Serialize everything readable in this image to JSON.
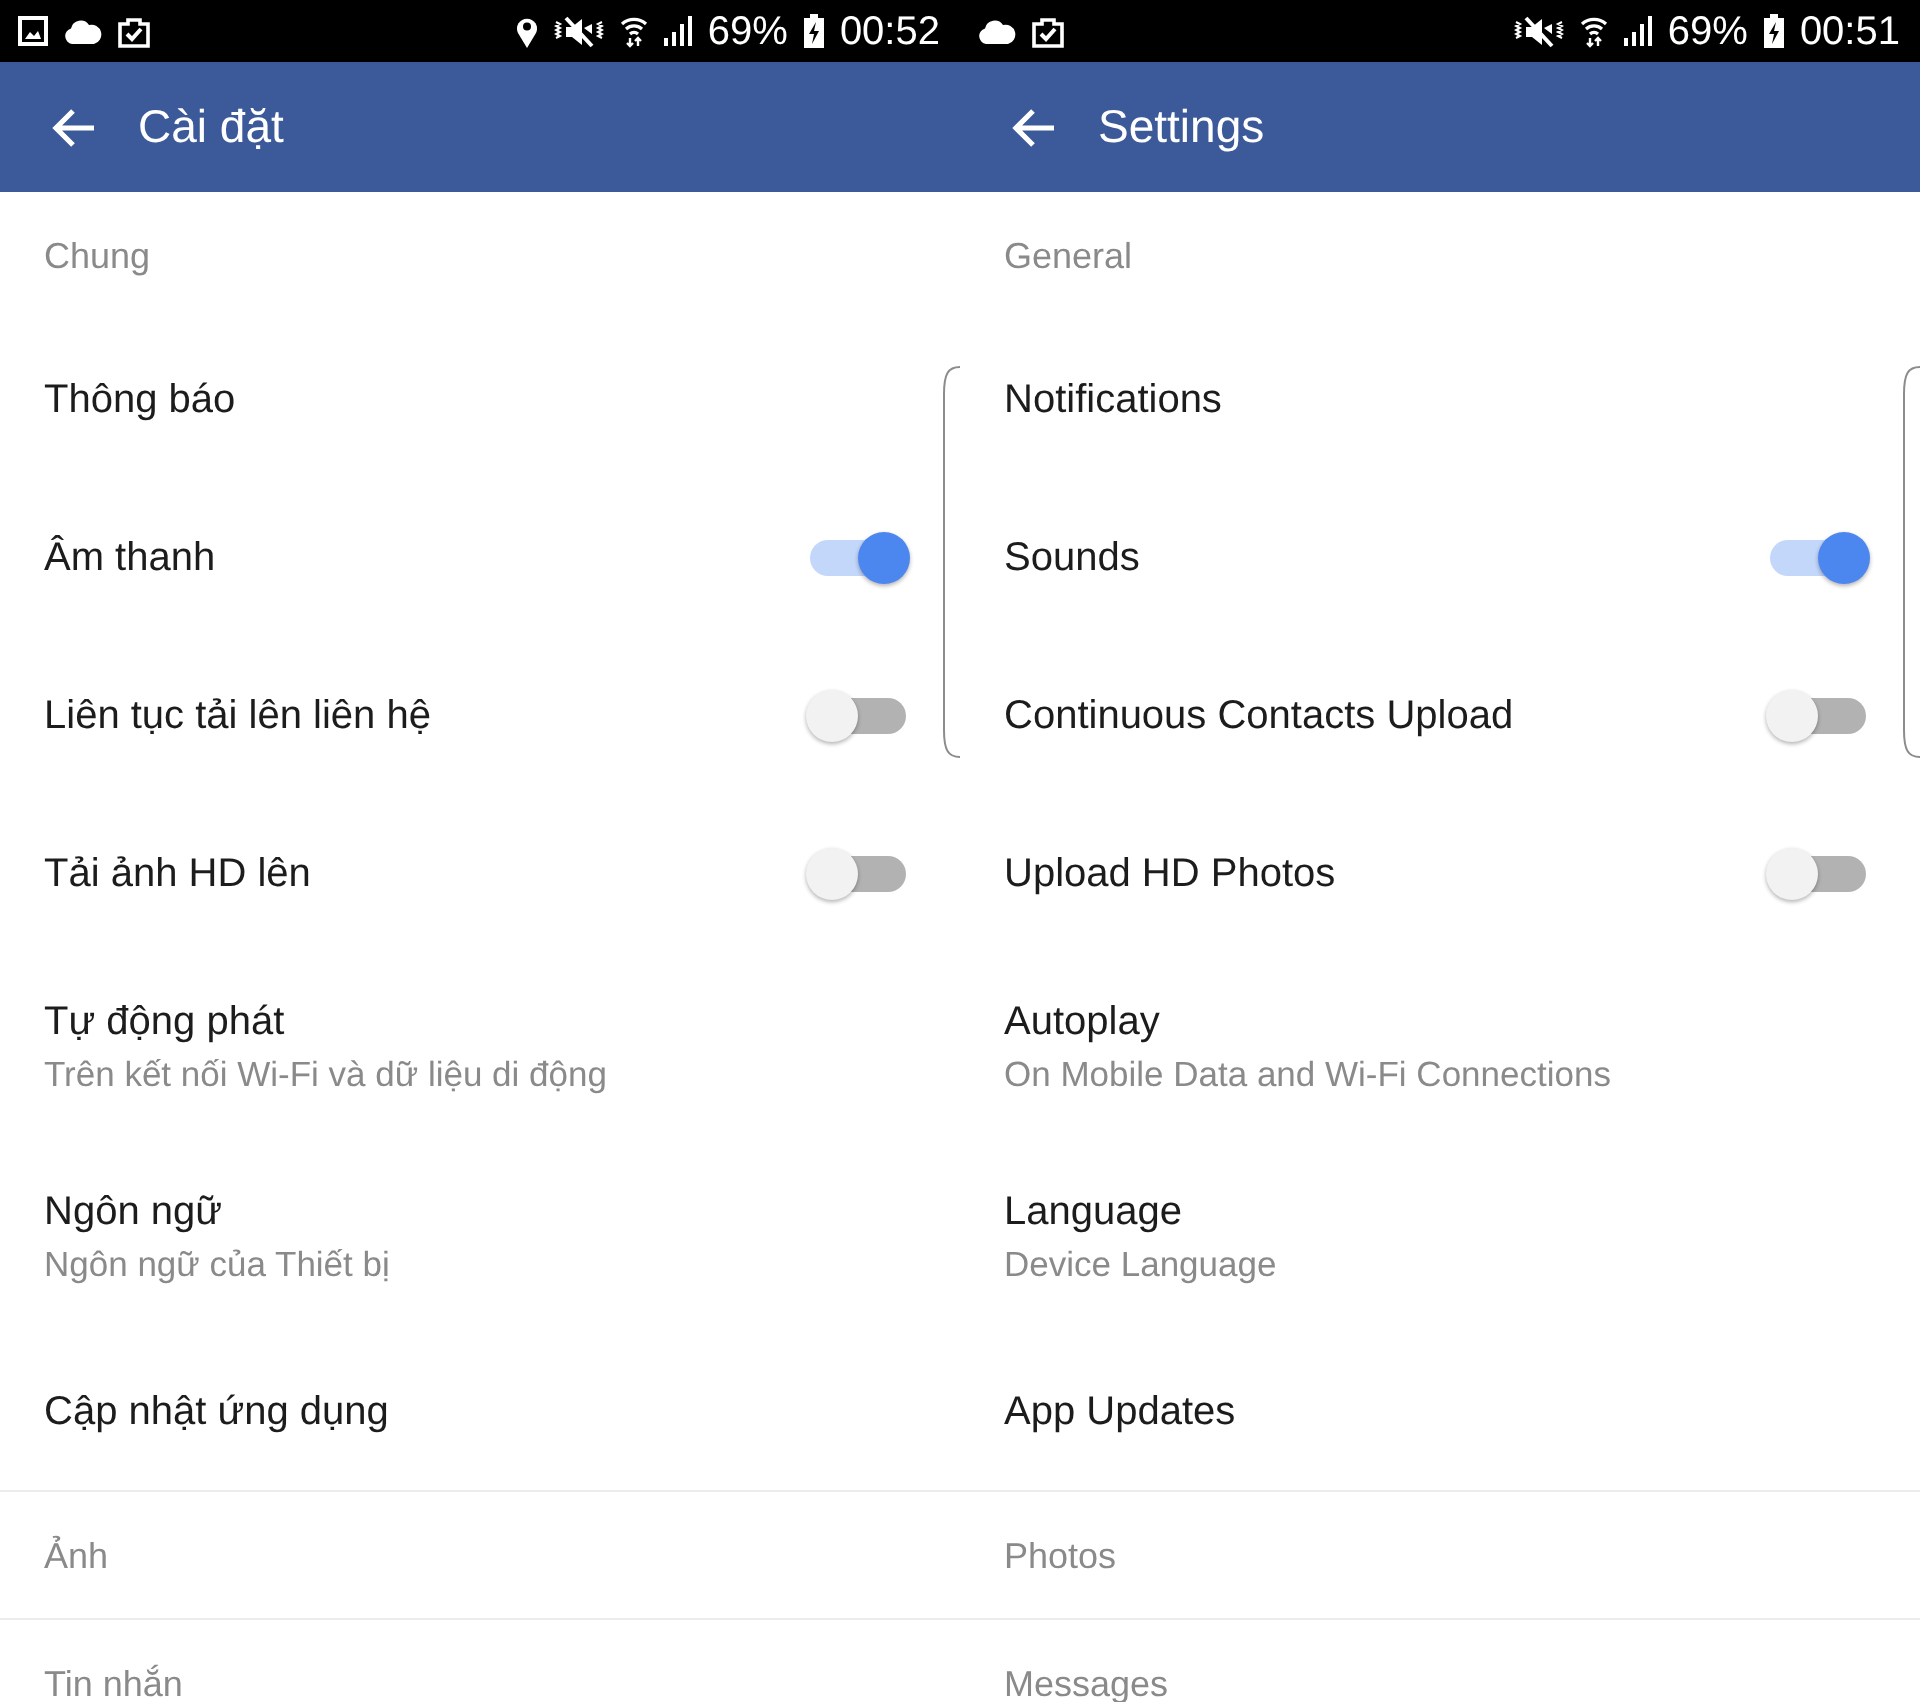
{
  "screens": [
    {
      "status_bar": {
        "notification_icons": [
          {
            "kind": "gallery"
          },
          {
            "kind": "cloud"
          },
          {
            "kind": "clipboard"
          }
        ],
        "system_icons": [
          {
            "kind": "location"
          },
          {
            "kind": "mute"
          },
          {
            "kind": "wifi"
          },
          {
            "kind": "signal"
          }
        ],
        "battery": "69%",
        "time": "00:52"
      },
      "header": {
        "title": "Cài đặt"
      },
      "items": [
        {
          "kind": "section",
          "label": "Chung"
        },
        {
          "kind": "link",
          "label": "Thông báo"
        },
        {
          "kind": "toggle",
          "label": "Âm thanh",
          "on": true
        },
        {
          "kind": "toggle",
          "label": "Liên tục tải lên liên hệ",
          "on": false
        },
        {
          "kind": "toggle",
          "label": "Tải ảnh HD lên",
          "on": false
        },
        {
          "kind": "detail",
          "label": "Tự động phát",
          "subtitle": "Trên kết nối Wi-Fi và dữ liệu di động"
        },
        {
          "kind": "detail",
          "label": "Ngôn ngữ",
          "subtitle": "Ngôn ngữ của Thiết bị"
        },
        {
          "kind": "link",
          "label": "Cập nhật ứng dụng"
        },
        {
          "kind": "section",
          "label": "Ảnh"
        },
        {
          "kind": "section",
          "label": "Tin nhắn"
        }
      ]
    },
    {
      "status_bar": {
        "notification_icons": [
          {
            "kind": "cloud"
          },
          {
            "kind": "clipboard"
          }
        ],
        "system_icons": [
          {
            "kind": "mute"
          },
          {
            "kind": "wifi"
          },
          {
            "kind": "signal"
          }
        ],
        "battery": "69%",
        "time": "00:51"
      },
      "header": {
        "title": "Settings"
      },
      "items": [
        {
          "kind": "section",
          "label": "General"
        },
        {
          "kind": "link",
          "label": "Notifications"
        },
        {
          "kind": "toggle",
          "label": "Sounds",
          "on": true
        },
        {
          "kind": "toggle",
          "label": "Continuous Contacts Upload",
          "on": false
        },
        {
          "kind": "toggle",
          "label": "Upload HD Photos",
          "on": false
        },
        {
          "kind": "detail",
          "label": "Autoplay",
          "subtitle": "On Mobile Data and Wi-Fi Connections"
        },
        {
          "kind": "detail",
          "label": "Language",
          "subtitle": "Device Language"
        },
        {
          "kind": "link",
          "label": "App Updates"
        },
        {
          "kind": "section",
          "label": "Photos"
        },
        {
          "kind": "section",
          "label": "Messages"
        }
      ]
    }
  ]
}
